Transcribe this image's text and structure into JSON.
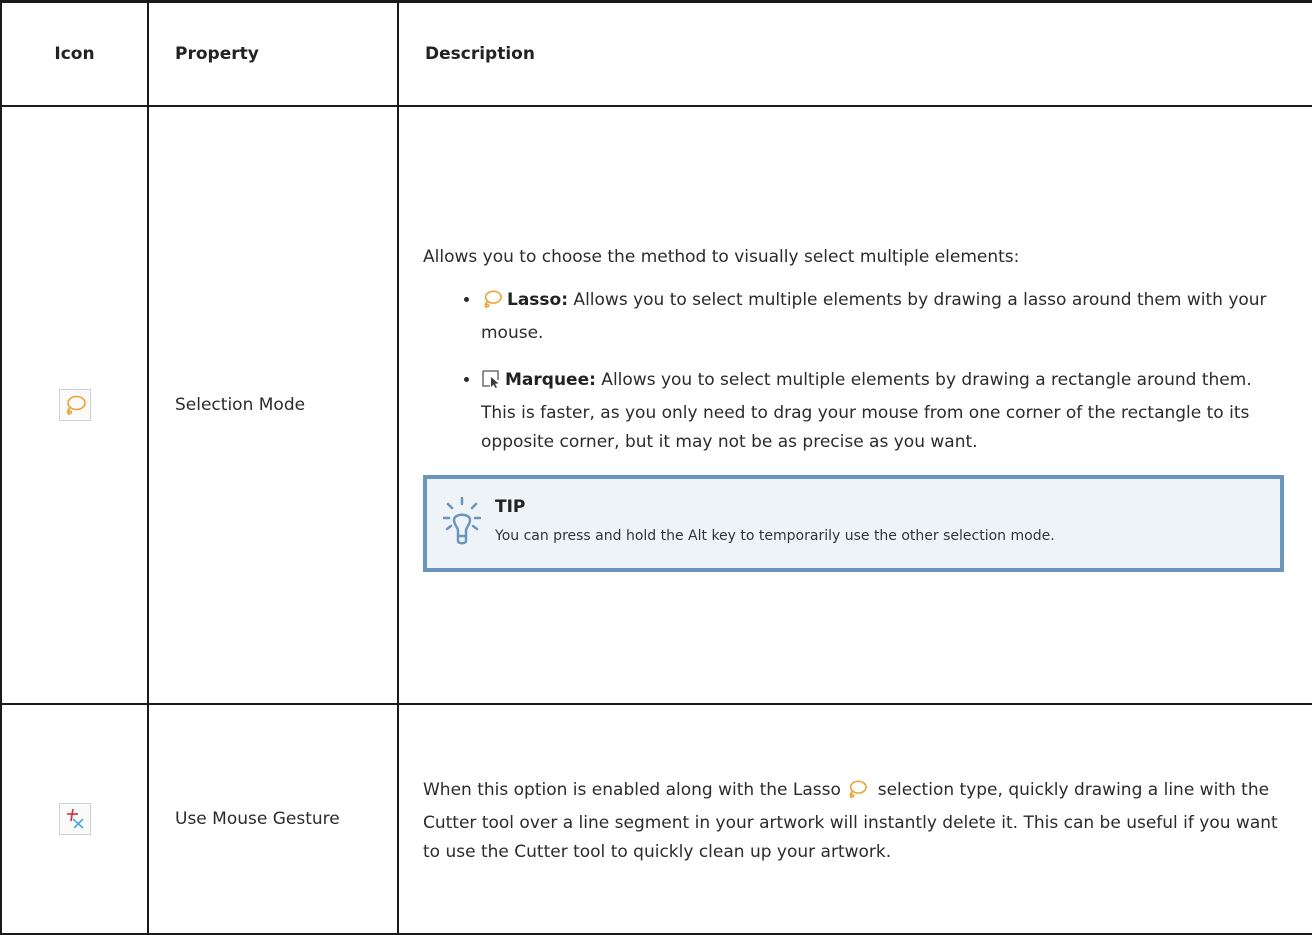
{
  "headers": {
    "icon": "Icon",
    "property": "Property",
    "description": "Description"
  },
  "rows": [
    {
      "icon": "lasso-icon",
      "property": "Selection Mode",
      "intro": "Allows you to choose the method to visually select multiple elements:",
      "bullets": [
        {
          "icon": "lasso-icon",
          "term": "Lasso:",
          "text": " Allows you to select multiple elements by drawing a lasso around them with your mouse."
        },
        {
          "icon": "marquee-icon",
          "term": "Marquee:",
          "text": " Allows you to select multiple elements by drawing a rectangle around them. This is faster, as you only need to drag your mouse from one corner of the rectangle to its opposite corner, but it may not be as precise as you want."
        }
      ],
      "tip": {
        "icon": "lightbulb-icon",
        "title": "TIP",
        "text": "You can press and hold the Alt key to temporarily use the other selection mode."
      }
    },
    {
      "icon": "mouse-gesture-icon",
      "property": "Use Mouse Gesture",
      "desc_before": "When this option is enabled along with the Lasso",
      "desc_after": " selection type, quickly drawing a line with the Cutter tool over a line segment in your artwork will instantly delete it. This can be useful if you want to use the Cutter tool to quickly clean up your artwork."
    }
  ],
  "colors": {
    "lasso": "#f0a030",
    "tip_border": "#6b95bc",
    "tip_bg": "#eef3f8",
    "gesture_red": "#d03030",
    "gesture_blue": "#4aa8e0"
  }
}
